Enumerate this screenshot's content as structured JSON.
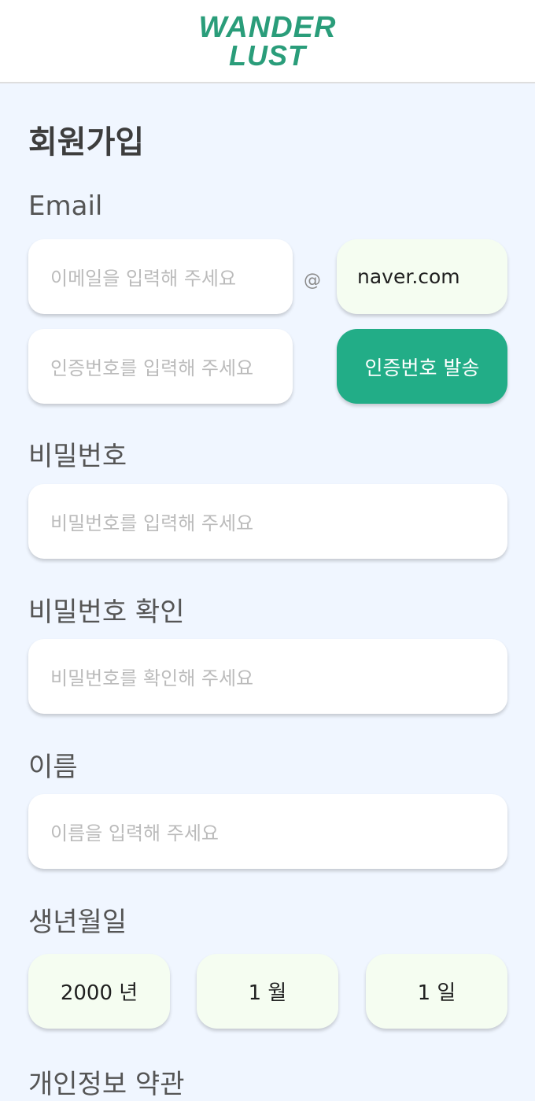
{
  "logo": {
    "line1": "WANDER",
    "line2": "LUST"
  },
  "page_title": "회원가입",
  "email": {
    "label": "Email",
    "placeholder": "이메일을 입력해 주세요",
    "at": "@",
    "domain": "naver.com",
    "code_placeholder": "인증번호를 입력해 주세요",
    "send_button": "인증번호 발송"
  },
  "password": {
    "label": "비밀번호",
    "placeholder": "비밀번호를 입력해 주세요"
  },
  "password_confirm": {
    "label": "비밀번호 확인",
    "placeholder": "비밀번호를 확인해 주세요"
  },
  "name": {
    "label": "이름",
    "placeholder": "이름을 입력해 주세요"
  },
  "birth": {
    "label": "생년월일",
    "year": "2000 년",
    "month": "1 월",
    "day": "1 일"
  },
  "terms": {
    "label": "개인정보 약관"
  },
  "colors": {
    "accent": "#22ad87",
    "background": "#f0f6ff",
    "select_bg": "#f5fdf1"
  }
}
